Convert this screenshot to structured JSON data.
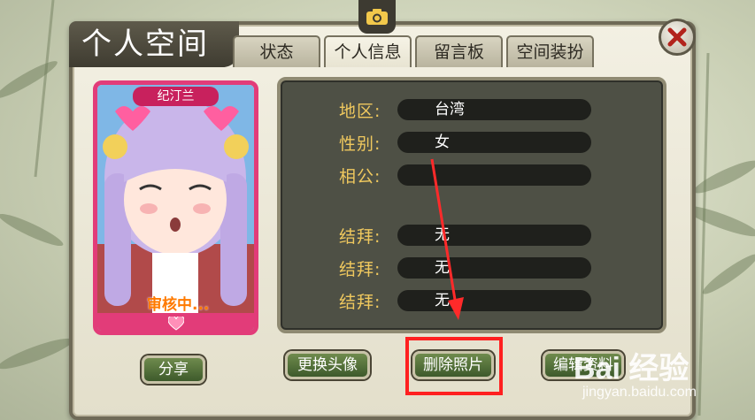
{
  "window": {
    "title": "个人空间"
  },
  "icons": {
    "camera": "camera-icon",
    "close": "close-icon",
    "heart": "heart-icon"
  },
  "tabs": [
    {
      "label": "状态",
      "active": false
    },
    {
      "label": "个人信息",
      "active": true
    },
    {
      "label": "留言板",
      "active": false
    },
    {
      "label": "空间装扮",
      "active": false
    }
  ],
  "portrait": {
    "name": "纪汀兰",
    "status": "审核中..."
  },
  "info": {
    "rows": [
      {
        "label": "地区:",
        "value": "台湾"
      },
      {
        "label": "性别:",
        "value": "女"
      },
      {
        "label": "相公:",
        "value": ""
      },
      {
        "label": "结拜:",
        "value": "无"
      },
      {
        "label": "结拜:",
        "value": "无"
      },
      {
        "label": "结拜:",
        "value": "无"
      }
    ]
  },
  "buttons": {
    "share": "分享",
    "change_avatar": "更换头像",
    "delete_photo": "删除照片",
    "edit_info": "编辑资料"
  },
  "watermark": {
    "logo": "Bai 经验",
    "url": "jingyan.baidu.com"
  },
  "colors": {
    "label_gold": "#efc85e",
    "highlight_red": "#ff2020",
    "button_green": "#4f6d36"
  }
}
